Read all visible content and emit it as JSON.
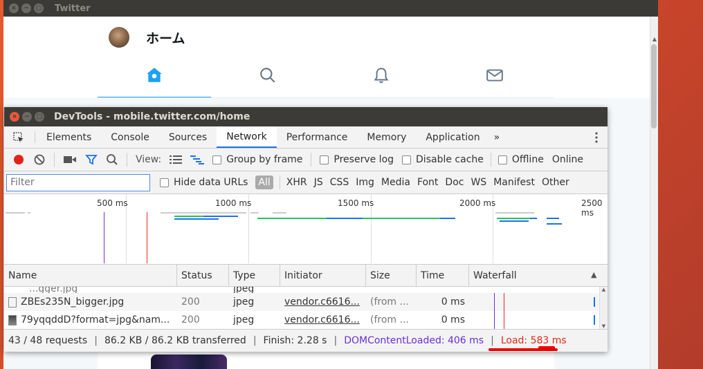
{
  "outer_window": {
    "title": "Twitter"
  },
  "twitter": {
    "page_title": "ホーム",
    "accent_color": "#1da1f2",
    "tabs": [
      {
        "icon": "home-icon",
        "active": true
      },
      {
        "icon": "search-icon",
        "active": false
      },
      {
        "icon": "bell-icon",
        "active": false
      },
      {
        "icon": "mail-icon",
        "active": false
      }
    ]
  },
  "devtools": {
    "title": "DevTools - mobile.twitter.com/home",
    "tabs": [
      "Elements",
      "Console",
      "Sources",
      "Network",
      "Performance",
      "Memory",
      "Application"
    ],
    "active_tab": "Network",
    "more_tabs": "»",
    "toolbar": {
      "view_label": "View:",
      "group_by_frame": "Group by frame",
      "preserve_log": "Preserve log",
      "disable_cache": "Disable cache",
      "offline": "Offline",
      "online": "Online"
    },
    "filter": {
      "placeholder": "Filter",
      "hide_data_urls": "Hide data URLs",
      "types": [
        "All",
        "XHR",
        "JS",
        "CSS",
        "Img",
        "Media",
        "Font",
        "Doc",
        "WS",
        "Manifest",
        "Other"
      ]
    },
    "overview_ticks": [
      "500 ms",
      "1000 ms",
      "1500 ms",
      "2000 ms",
      "2500 ms"
    ],
    "columns": [
      "Name",
      "Status",
      "Type",
      "Initiator",
      "Size",
      "Time",
      "Waterfall"
    ],
    "rows": [
      {
        "name": "...gger.jpg",
        "status": "",
        "type": "jpeg",
        "initiator": "",
        "size": "",
        "time": "",
        "partial": true
      },
      {
        "name": "ZBEs235N_bigger.jpg",
        "status": "200",
        "type": "jpeg",
        "initiator": "vendor.c6616...",
        "size": "(from ...",
        "time": "0 ms"
      },
      {
        "name": "79yqqddD?format=jpg&nam...",
        "status": "200",
        "type": "jpeg",
        "initiator": "vendor.c6616...",
        "size": "(from ...",
        "time": "0 ms"
      }
    ],
    "status": {
      "requests": "43 / 48 requests",
      "transferred": "86.2 KB / 86.2 KB transferred",
      "finish": "Finish: 2.28 s",
      "dom_content_loaded": "DOMContentLoaded: 406 ms",
      "load": "Load: 583 ms",
      "dcl_color": "#6b2fd6",
      "load_color": "#e0281d"
    }
  }
}
